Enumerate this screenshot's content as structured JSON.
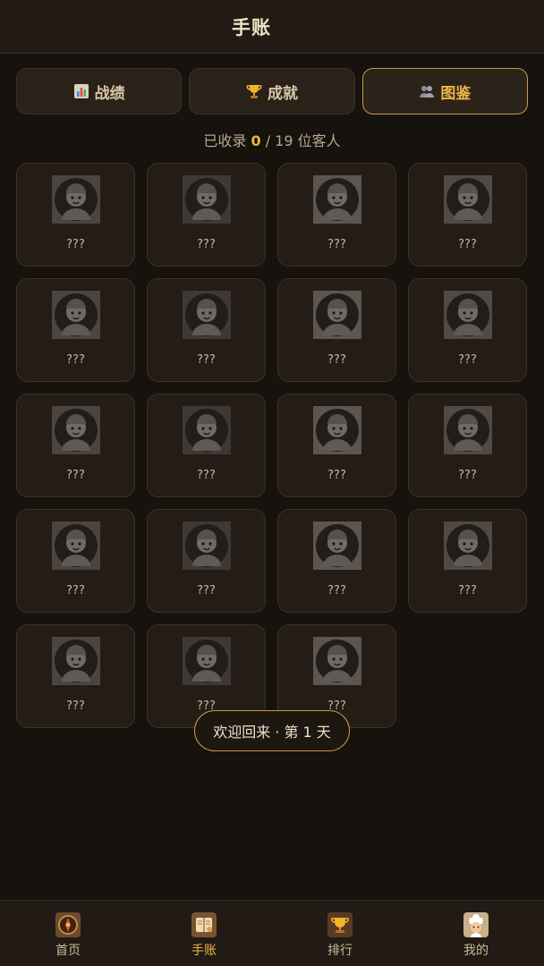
{
  "header": {
    "title": "手账"
  },
  "tabs": [
    {
      "label": "战绩",
      "icon": "bar-chart-icon",
      "active": false
    },
    {
      "label": "成就",
      "icon": "trophy-icon",
      "active": false
    },
    {
      "label": "图鉴",
      "icon": "people-icon",
      "active": true
    }
  ],
  "collection": {
    "prefix": "已收录",
    "collected": "0",
    "separator": "/",
    "total": "19",
    "suffix": "位客人"
  },
  "cards": [
    {
      "name": "???",
      "icon": "bald-elder-portrait-icon"
    },
    {
      "name": "???",
      "icon": "glasses-woman-portrait-icon"
    },
    {
      "name": "???",
      "icon": "cap-grandpa-portrait-icon"
    },
    {
      "name": "???",
      "icon": "bearded-grandpa-portrait-icon"
    },
    {
      "name": "???",
      "icon": "bun-granny-portrait-icon"
    },
    {
      "name": "???",
      "icon": "sunglasses-man-portrait-icon"
    },
    {
      "name": "???",
      "icon": "helmet-worker-portrait-icon"
    },
    {
      "name": "???",
      "icon": "headband-auntie-portrait-icon"
    },
    {
      "name": "???",
      "icon": "courier-man-portrait-icon"
    },
    {
      "name": "???",
      "icon": "young-man-portrait-icon"
    },
    {
      "name": "???",
      "icon": "mohawk-kid-portrait-icon"
    },
    {
      "name": "???",
      "icon": "cowboy-portrait-icon"
    },
    {
      "name": "???",
      "icon": "pigtails-girl-portrait-icon"
    },
    {
      "name": "???",
      "icon": "bald-beard-man-portrait-icon"
    },
    {
      "name": "???",
      "icon": "long-hair-woman-portrait-icon"
    },
    {
      "name": "???",
      "icon": "officer-portrait-icon"
    },
    {
      "name": "???",
      "icon": "soldier-portrait-icon"
    },
    {
      "name": "???",
      "icon": "waving-worker-portrait-icon"
    },
    {
      "name": "???",
      "icon": "scarf-elder-portrait-icon"
    }
  ],
  "toast": {
    "text": "欢迎回来 · 第 1 天"
  },
  "nav": [
    {
      "label": "首页",
      "icon": "home-compass-icon",
      "active": false
    },
    {
      "label": "手账",
      "icon": "notebook-icon",
      "active": true
    },
    {
      "label": "排行",
      "icon": "leaderboard-trophy-icon",
      "active": false
    },
    {
      "label": "我的",
      "icon": "chef-avatar-icon",
      "active": false
    }
  ],
  "colors": {
    "background": "#16120e",
    "panel": "#241c15",
    "accent": "#f0b547",
    "border_active": "#c89a48"
  }
}
